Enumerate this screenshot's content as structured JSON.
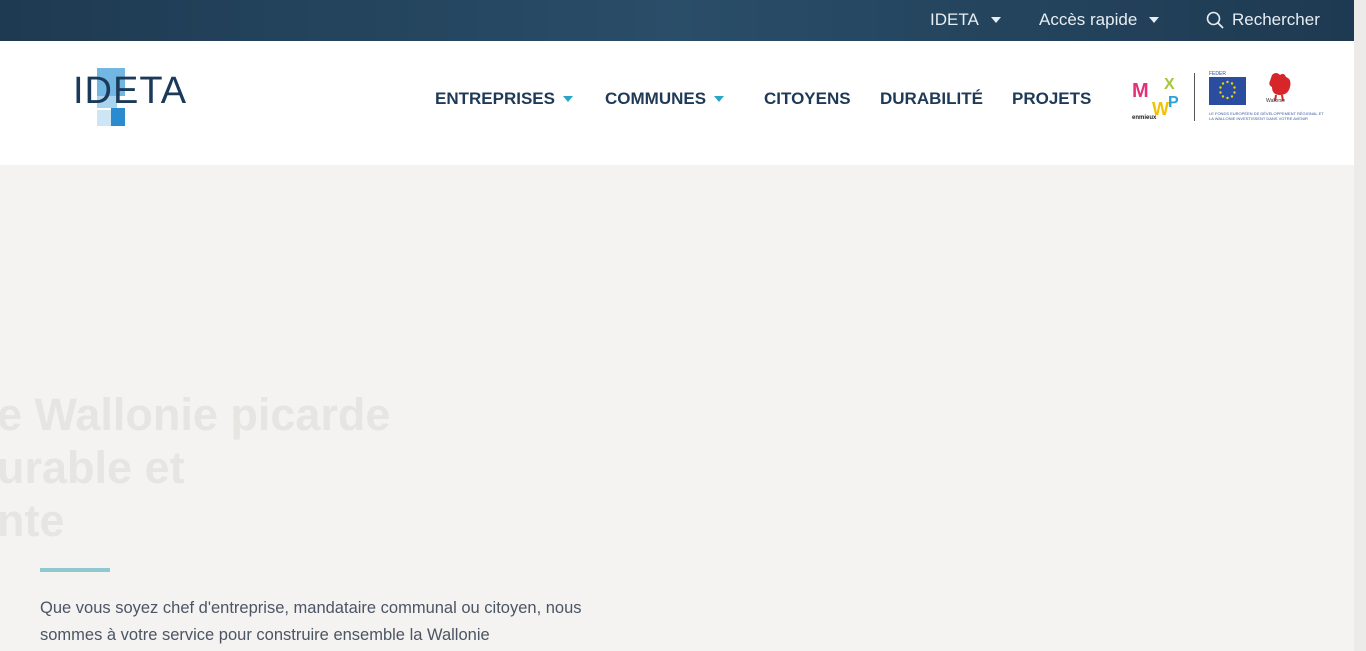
{
  "topbar": {
    "ideta_label": "IDETA",
    "acces_label": "Accès rapide",
    "search_label": "Rechercher"
  },
  "header": {
    "logo_text": "IDETA",
    "nav": [
      {
        "label": "ENTREPRISES",
        "has_dropdown": true
      },
      {
        "label": "COMMUNES",
        "has_dropdown": true
      },
      {
        "label": "CITOYENS",
        "has_dropdown": false
      },
      {
        "label": "DURABILITÉ",
        "has_dropdown": false
      },
      {
        "label": "PROJETS",
        "has_dropdown": false
      }
    ],
    "partners": {
      "mw_caption": "enmieux",
      "feder_label": "FEDER",
      "eu_caption": "LE FONDS EUROPÉEN DE DÉVELOPPEMENT RÉGIONAL ET LA WALLONIE INVESTISSENT DANS VOTRE AVENIR",
      "wallonie_label": "Wallonie"
    }
  },
  "hero": {
    "title_line1": "e Wallonie picarde",
    "title_line2": "urable et",
    "title_line3": "nte",
    "text": "Que vous soyez chef d'entreprise, mandataire communal ou citoyen, nous sommes à votre service pour construire ensemble la Wallonie"
  },
  "colors": {
    "topbar_bg": "#1e3a52",
    "nav_text": "#1f3a56",
    "accent": "#29a6c7",
    "hero_bg": "#f4f3f1"
  },
  "icons": {
    "search": "search-icon",
    "caret": "caret-down-icon"
  }
}
